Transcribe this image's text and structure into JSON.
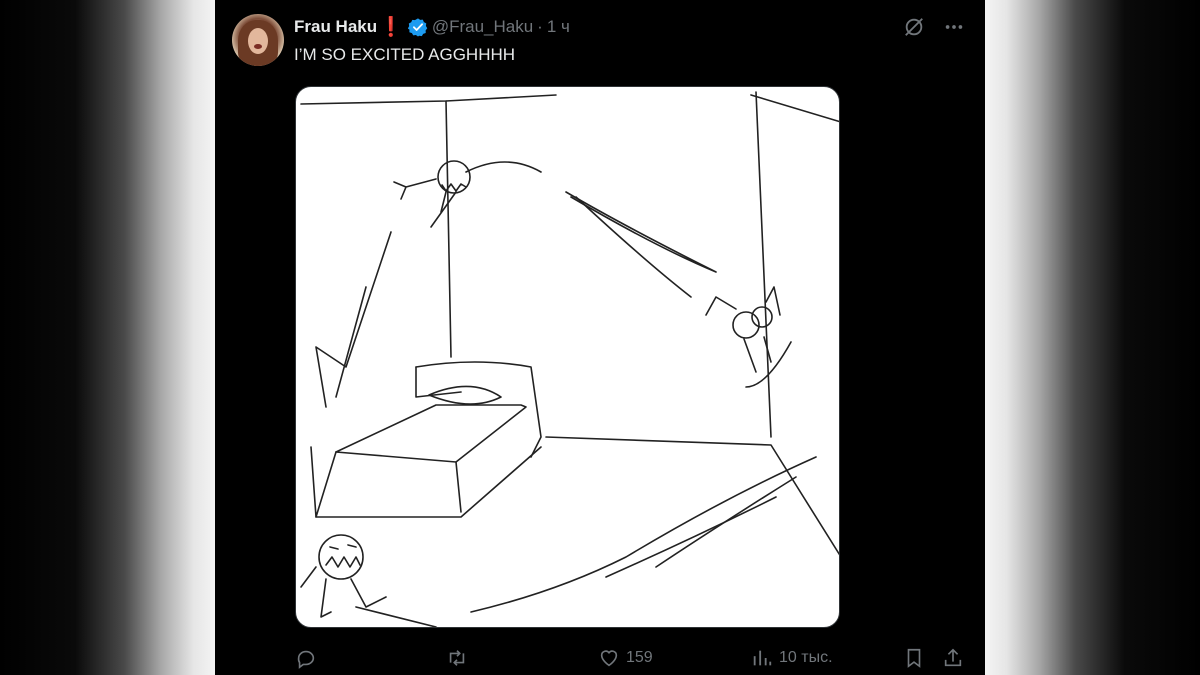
{
  "author": {
    "name": "Frau Haku",
    "badge": "❗",
    "handle": "@Frau_Haku",
    "separator": "·",
    "time": "1 ч"
  },
  "tweet": {
    "text": "I’M SO EXCITED AGGHHHH",
    "media_alt_icon": "sketch-drawing"
  },
  "icons": {
    "top": [
      "grok-icon",
      "more-icon"
    ],
    "actions": [
      "reply-icon",
      "retweet-icon",
      "like-icon",
      "views-icon",
      "bookmark-icon",
      "share-icon"
    ]
  },
  "metrics": {
    "likes": "159",
    "views": "10 тыс."
  },
  "colors": {
    "background": "#000000",
    "text": "#e7e9ea",
    "muted": "#71767b",
    "verified": "#1d9bf0",
    "badge": "#e0245e"
  }
}
